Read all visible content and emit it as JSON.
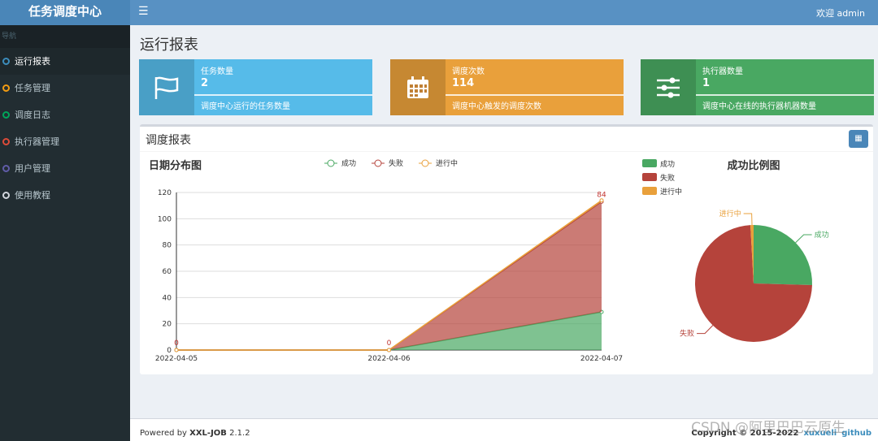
{
  "app": {
    "title": "任务调度中心",
    "welcome": "欢迎 admin"
  },
  "sidebar": {
    "header": "导航",
    "items": [
      {
        "label": "运行报表",
        "color": "#3c8dbc",
        "active": true
      },
      {
        "label": "任务管理",
        "color": "#f39c12"
      },
      {
        "label": "调度日志",
        "color": "#00a65a"
      },
      {
        "label": "执行器管理",
        "color": "#dd4b39"
      },
      {
        "label": "用户管理",
        "color": "#605ca8"
      },
      {
        "label": "使用教程",
        "color": "#d2d6de"
      }
    ]
  },
  "page": {
    "title": "运行报表"
  },
  "stats": [
    {
      "title": "任务数量",
      "value": "2",
      "desc": "调度中心运行的任务数量",
      "color": "#56bbe9",
      "icon": "flag-icon"
    },
    {
      "title": "调度次数",
      "value": "114",
      "desc": "调度中心触发的调度次数",
      "color": "#e9a03b",
      "icon": "calendar-icon"
    },
    {
      "title": "执行器数量",
      "value": "1",
      "desc": "调度中心在线的执行器机器数量",
      "color": "#49a862",
      "icon": "sliders-icon"
    }
  ],
  "report": {
    "title": "调度报表"
  },
  "chart_data": [
    {
      "type": "area",
      "stacked": true,
      "title": "日期分布图",
      "categories": [
        "2022-04-05",
        "2022-04-06",
        "2022-04-07"
      ],
      "ylim": [
        0,
        120
      ],
      "yticks": [
        0,
        20,
        40,
        60,
        80,
        100,
        120
      ],
      "grid": true,
      "legend": "top-center",
      "series": [
        {
          "name": "成功",
          "values": [
            0,
            0,
            29
          ],
          "color": "#49a862"
        },
        {
          "name": "失败",
          "values": [
            0,
            0,
            84
          ],
          "color": "#b5433b"
        },
        {
          "name": "进行中",
          "values": [
            0,
            0,
            1
          ],
          "color": "#e9a03b"
        }
      ],
      "data_labels": [
        "0",
        "0",
        "84"
      ]
    },
    {
      "type": "pie",
      "title": "成功比例图",
      "legend": "top-left",
      "slices": [
        {
          "name": "成功",
          "value": 29,
          "color": "#49a862"
        },
        {
          "name": "失败",
          "value": 84,
          "color": "#b5433b"
        },
        {
          "name": "进行中",
          "value": 1,
          "color": "#e9a03b"
        }
      ]
    }
  ],
  "footer": {
    "powered": "Powered by ",
    "brand": "XXL-JOB",
    "version": " 2.1.2",
    "copyright": "Copyright © 2015-2022",
    "link1": "xuxueli",
    "link2": "github"
  },
  "watermark": "CSDN @阿里巴巴云原生"
}
